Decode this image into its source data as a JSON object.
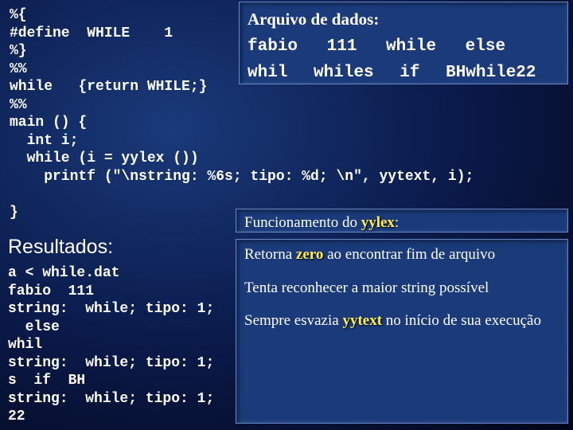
{
  "code": "%{\n#define  WHILE    1\n%}\n%%\nwhile   {return WHILE;}\n%%\nmain () {\n  int i;\n  while (i = yylex ())\n    printf (\"\\nstring: %6s; tipo: %d; \\n\", yytext, i);\n\n}",
  "arquivo": {
    "title": "Arquivo de dados:",
    "line1": [
      "fabio",
      "111",
      "while",
      "else"
    ],
    "line2": [
      "whil",
      "whiles",
      "if",
      "BHwhile22"
    ]
  },
  "func": {
    "prefix": "Funcionamento  do ",
    "yylex": "yylex",
    "suffix": ":"
  },
  "resultados": {
    "header": "Resultados:",
    "output": "a < while.dat\nfabio  111\nstring:  while; tipo: 1;\n  else\nwhil\nstring:  while; tipo: 1;\ns  if  BH\nstring:  while; tipo: 1;\n22"
  },
  "notes": {
    "p1a": "Retorna ",
    "p1kw": "zero",
    "p1b": " ao encontrar fim de arquivo",
    "p2": "Tenta reconhecer a maior string possível",
    "p3a": "Sempre esvazia ",
    "p3kw": "yytext",
    "p3b": " no início de sua execução"
  }
}
